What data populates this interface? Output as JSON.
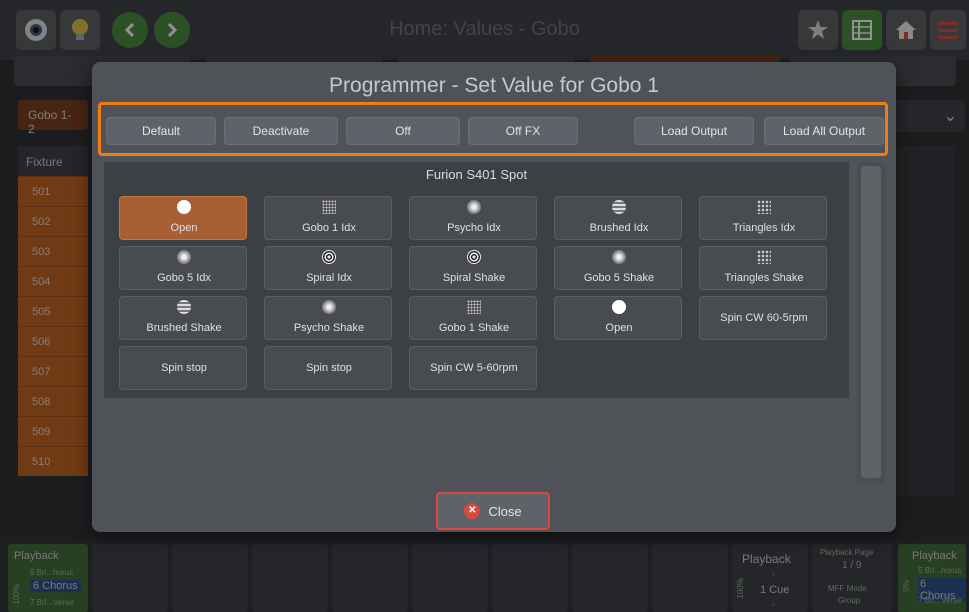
{
  "app": {
    "title": "Home: Values - Gobo",
    "fixture_group": "Gobo 1-2",
    "colors": {
      "accent": "#f07c16",
      "selected": "#a95f34",
      "fixture": "#c4621e",
      "playback": "#3f6a35",
      "close": "#d84a3c"
    }
  },
  "topbar": {
    "icons": [
      "eye-icon",
      "lightbulb-icon",
      "back-icon",
      "forward-icon",
      "star-icon",
      "grid-icon",
      "home-icon",
      "menu-icon"
    ]
  },
  "fixture_list": {
    "header": "Fixture",
    "rows": [
      "501",
      "502",
      "503",
      "504",
      "505",
      "506",
      "507",
      "508",
      "509",
      "510"
    ]
  },
  "dialog": {
    "title": "Programmer - Set Value for Gobo 1",
    "actions": [
      {
        "label": "Default"
      },
      {
        "label": "Deactivate"
      },
      {
        "label": "Off"
      },
      {
        "label": "Off FX"
      },
      {
        "label": "Load Output"
      },
      {
        "label": "Load All Output"
      }
    ],
    "panel_title": "Furion S401 Spot",
    "gobos": [
      {
        "label": "Open",
        "icon": "open",
        "selected": true
      },
      {
        "label": "Gobo 1 Idx",
        "icon": "speckle"
      },
      {
        "label": "Psycho Idx",
        "icon": "disc"
      },
      {
        "label": "Brushed Idx",
        "icon": "brush"
      },
      {
        "label": "Triangles Idx",
        "icon": "tri"
      },
      {
        "label": "Gobo 5 Idx",
        "icon": "disc"
      },
      {
        "label": "Spiral Idx",
        "icon": "spiral"
      },
      {
        "label": "Spiral Shake",
        "icon": "spiral"
      },
      {
        "label": "Gobo 5 Shake",
        "icon": "disc"
      },
      {
        "label": "Triangles Shake",
        "icon": "tri"
      },
      {
        "label": "Brushed Shake",
        "icon": "brush"
      },
      {
        "label": "Psycho Shake",
        "icon": "disc"
      },
      {
        "label": "Gobo 1 Shake",
        "icon": "speckle"
      },
      {
        "label": "Open",
        "icon": "open"
      },
      {
        "label": "Spin CW 60-5rpm",
        "icon": ""
      },
      {
        "label": "Spin stop",
        "icon": ""
      },
      {
        "label": "Spin stop",
        "icon": ""
      },
      {
        "label": "Spin CW 5-60rpm",
        "icon": ""
      }
    ],
    "close_label": "Close"
  },
  "playback": {
    "left": {
      "title": "Playback",
      "level": "100%",
      "prev": "5 Bri...horus",
      "current": "6 Chorus",
      "next": "7 Bri...Verse"
    },
    "center": {
      "title": "Playback",
      "level": "100%",
      "cue": "1 Cue",
      "dash1": "-",
      "dash2": "-"
    },
    "page": {
      "title": "Playback Page",
      "value": "1 / 9",
      "mode_label": "MFF Mode",
      "mode_value": "Group"
    },
    "right": {
      "title": "Playback",
      "level": "0%",
      "prev": "5 Bri...horus",
      "current": "6 Chorus",
      "next": "7 Bri...Verse"
    }
  }
}
